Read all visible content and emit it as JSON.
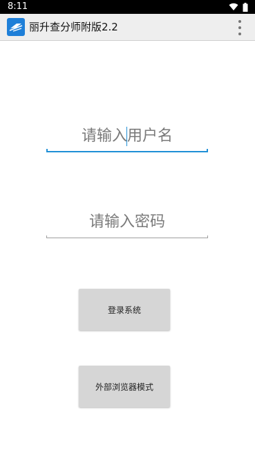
{
  "status_bar": {
    "time": "8:11",
    "icons": [
      "wifi-icon",
      "battery-icon"
    ]
  },
  "app_bar": {
    "title": "丽升查分师附版2.2",
    "logo_icon": "app-logo-icon",
    "overflow_icon": "more-vert-icon"
  },
  "login_form": {
    "username_placeholder": "请输入用户名",
    "password_placeholder": "请输入密码"
  },
  "buttons": {
    "login_label": "登录系统",
    "browser_mode_label": "外部浏览器模式"
  },
  "colors": {
    "accent": "#1f8fd6",
    "app_bar": "#eeeeee",
    "button": "#d6d6d6",
    "status_bar": "#000000"
  }
}
